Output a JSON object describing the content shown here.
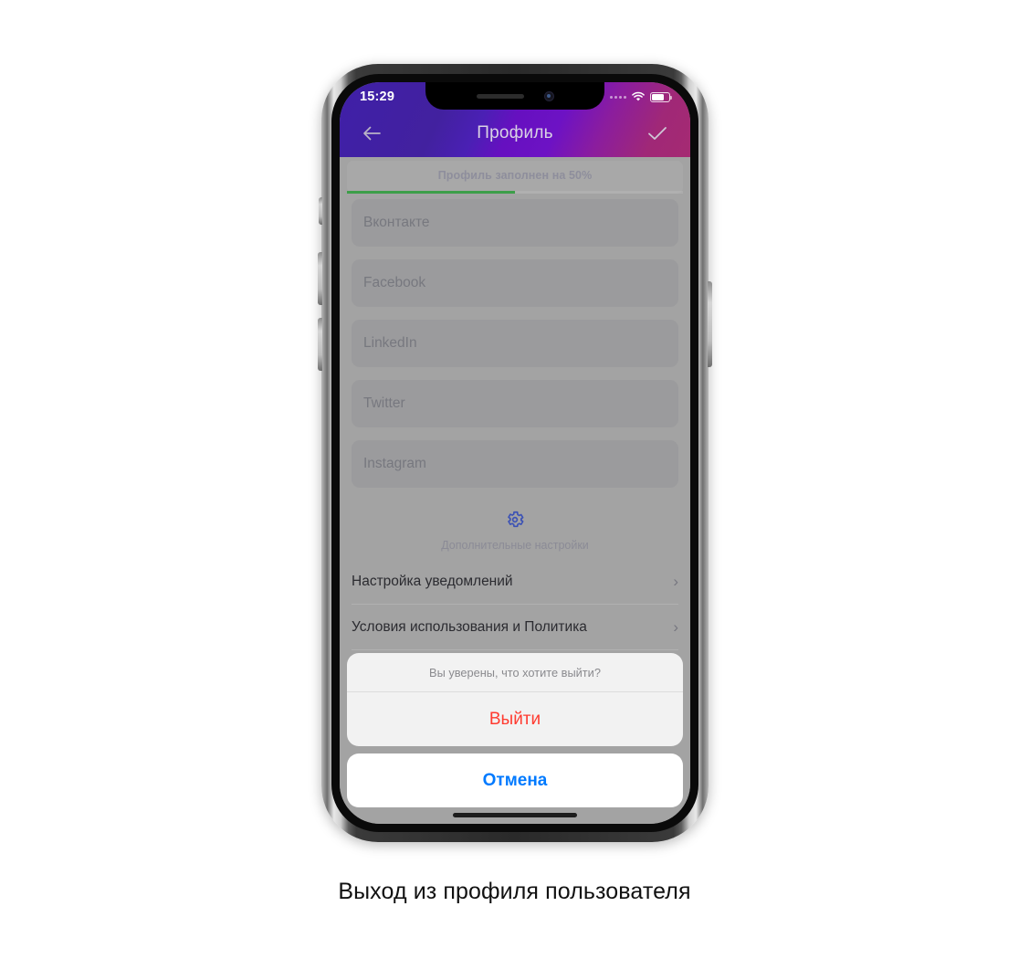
{
  "caption": "Выход из профиля пользователя",
  "phone": {
    "status_bar": {
      "time": "15:29",
      "signal_icon": "signal-dots-icon",
      "wifi_icon": "wifi-icon",
      "battery_icon": "battery-icon"
    },
    "header": {
      "back_icon": "arrow-left-icon",
      "title": "Профиль",
      "done_icon": "checkmark-icon",
      "gradient_start": "#3f1fa8",
      "gradient_mid": "#6610c0",
      "gradient_end": "#a52a72"
    },
    "progress": {
      "label": "Профиль заполнен на 50%",
      "percent": 50,
      "bar_color": "#3d9e49"
    },
    "fields": [
      {
        "placeholder": "Вконтакте",
        "value": "",
        "name": "vkontakte"
      },
      {
        "placeholder": "Facebook",
        "value": "",
        "name": "facebook"
      },
      {
        "placeholder": "LinkedIn",
        "value": "",
        "name": "linkedin"
      },
      {
        "placeholder": "Twitter",
        "value": "",
        "name": "twitter"
      },
      {
        "placeholder": "Instagram",
        "value": "",
        "name": "instagram"
      }
    ],
    "extra_settings": {
      "icon": "gear-icon",
      "icon_color": "#3c52b5",
      "label": "Дополнительные настройки"
    },
    "menu_rows": [
      {
        "label": "Настройка уведомлений",
        "chevron": "›"
      },
      {
        "label": "Условия использования и Политика",
        "chevron": "›"
      }
    ],
    "action_sheet": {
      "title": "Вы уверены, что хотите выйти?",
      "destructive_label": "Выйти",
      "destructive_color": "#ff3b30",
      "cancel_label": "Отмена",
      "cancel_color": "#007aff"
    }
  }
}
